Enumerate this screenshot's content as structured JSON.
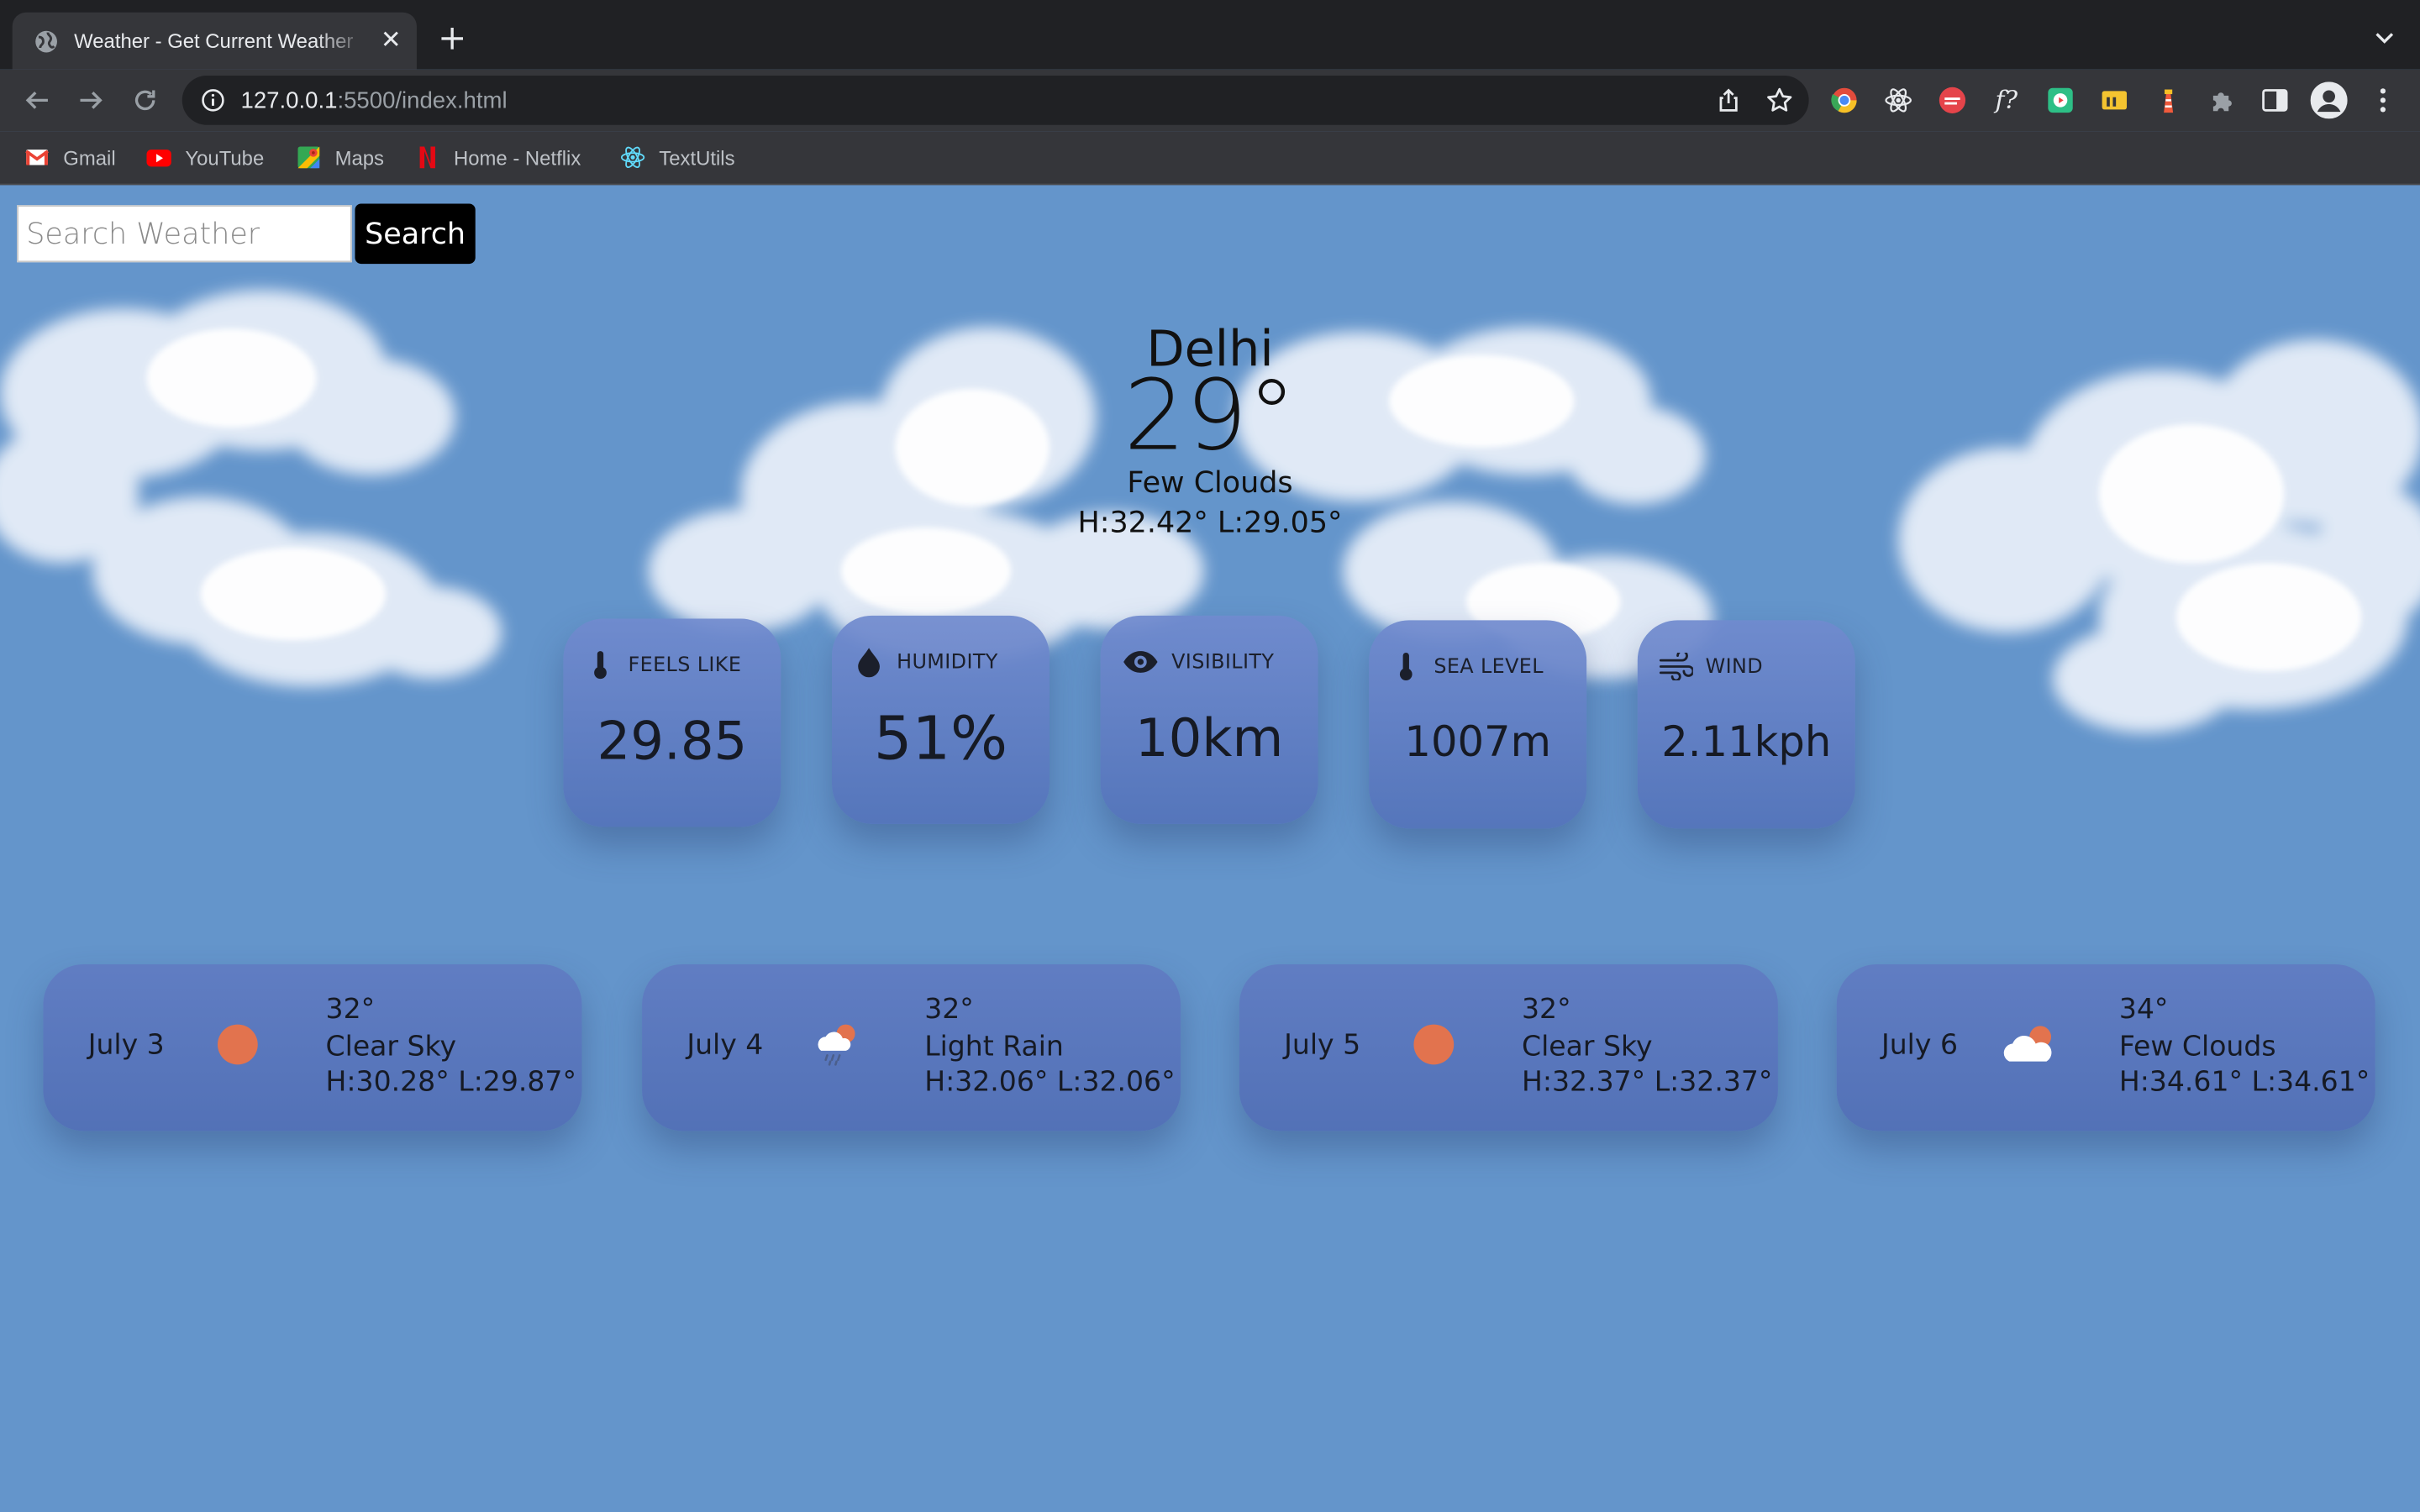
{
  "browser": {
    "tab_title": "Weather - Get Current Weather",
    "url_host": "127.0.0.1",
    "url_rest": ":5500/index.html",
    "bookmarks": [
      {
        "label": "Gmail",
        "icon": "gmail-icon"
      },
      {
        "label": "YouTube",
        "icon": "youtube-icon"
      },
      {
        "label": "Maps",
        "icon": "maps-icon"
      },
      {
        "label": "Home - Netflix",
        "icon": "netflix-icon"
      },
      {
        "label": "TextUtils",
        "icon": "react-icon"
      }
    ]
  },
  "search": {
    "placeholder": "Search Weather",
    "button_label": "Search"
  },
  "current": {
    "city": "Delhi",
    "temp": "29°",
    "condition": "Few Clouds",
    "hilo": "H:32.42° L:29.05°"
  },
  "stats": [
    {
      "label": "FEELS LIKE",
      "value": "29.85",
      "icon": "thermometer-icon"
    },
    {
      "label": "HUMIDITY",
      "value": "51%",
      "icon": "droplet-icon"
    },
    {
      "label": "VISIBILITY",
      "value": "10km",
      "icon": "eye-icon"
    },
    {
      "label": "SEA LEVEL",
      "value": "1007m",
      "icon": "thermometer-icon"
    },
    {
      "label": "WIND",
      "value": "2.11kph",
      "icon": "wind-icon"
    }
  ],
  "forecast": [
    {
      "date": "July 3",
      "temp": "32°",
      "condition": "Clear Sky",
      "hilo": "H:30.28° L:29.87°",
      "icon": "sun-icon"
    },
    {
      "date": "July 4",
      "temp": "32°",
      "condition": "Light Rain",
      "hilo": "H:32.06° L:32.06°",
      "icon": "rain-cloud-icon"
    },
    {
      "date": "July 5",
      "temp": "32°",
      "condition": "Clear Sky",
      "hilo": "H:32.37° L:32.37°",
      "icon": "sun-icon"
    },
    {
      "date": "July 6",
      "temp": "34°",
      "condition": "Few Clouds",
      "hilo": "H:34.61° L:34.61°",
      "icon": "cloud-sun-icon"
    }
  ],
  "colors": {
    "page_bg": "#6495cb",
    "card_bg": "#5a78bb",
    "sun": "#e2734e",
    "search_button": "#000000"
  }
}
